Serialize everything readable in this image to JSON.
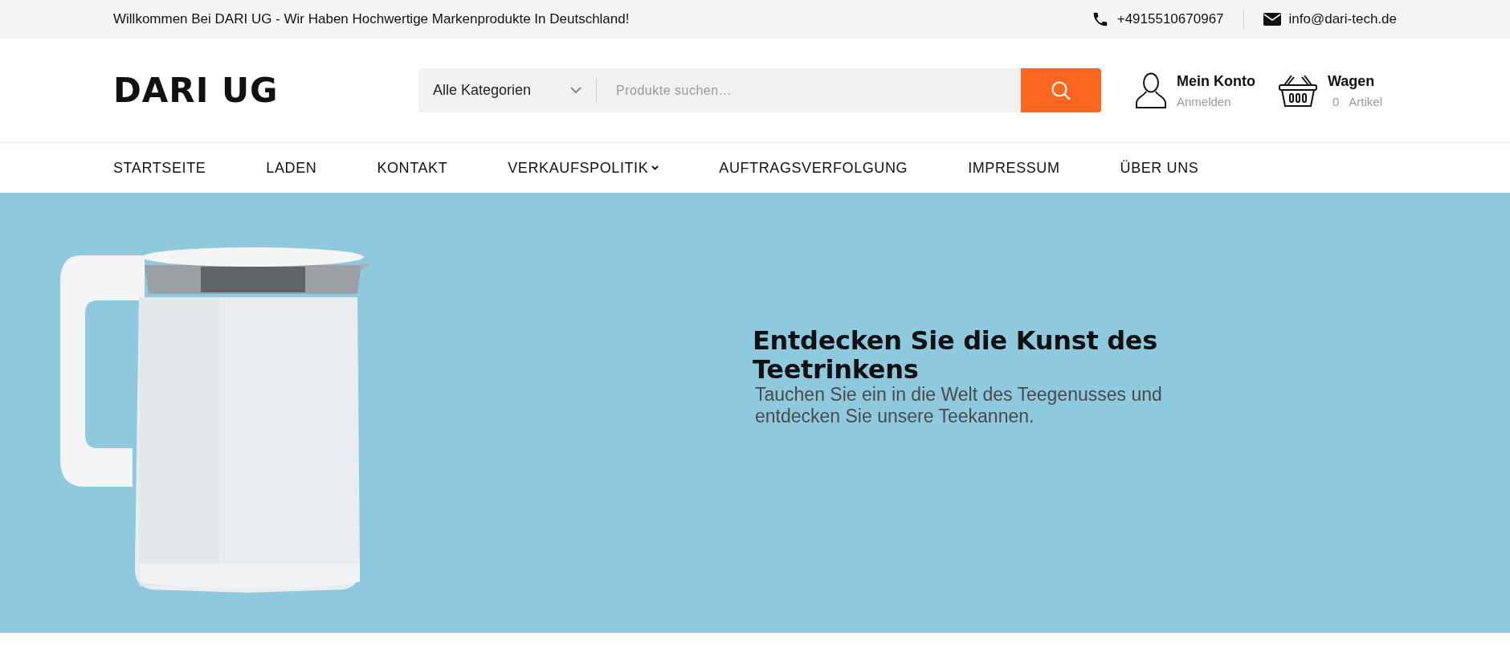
{
  "top_bar": {
    "welcome": "Willkommen Bei DARI UG - Wir Haben Hochwertige Markenprodukte In Deutschland!",
    "phone": "+4915510670967",
    "email": "info@dari-tech.de"
  },
  "header": {
    "logo": "DARI UG",
    "search": {
      "category": "Alle Kategorien",
      "placeholder": "Produkte suchen…"
    },
    "account": {
      "title": "Mein Konto",
      "subtitle": "Anmelden"
    },
    "cart": {
      "title": "Wagen",
      "count": "0",
      "unit": "Artikel"
    }
  },
  "nav": [
    {
      "label": "STARTSEITE",
      "dropdown": false
    },
    {
      "label": "LADEN",
      "dropdown": false
    },
    {
      "label": "KONTAKT",
      "dropdown": false
    },
    {
      "label": "VERKAUFSPOLITIK",
      "dropdown": true
    },
    {
      "label": "AUFTRAGSVERFOLGUNG",
      "dropdown": false
    },
    {
      "label": "IMPRESSUM",
      "dropdown": false
    },
    {
      "label": "ÜBER UNS",
      "dropdown": false
    }
  ],
  "hero": {
    "heading": "Entdecken Sie die Kunst des Teetrinkens",
    "text": "Tauchen Sie ein in die Welt des Teegenusses und entdecken Sie unsere Teekannen."
  }
}
